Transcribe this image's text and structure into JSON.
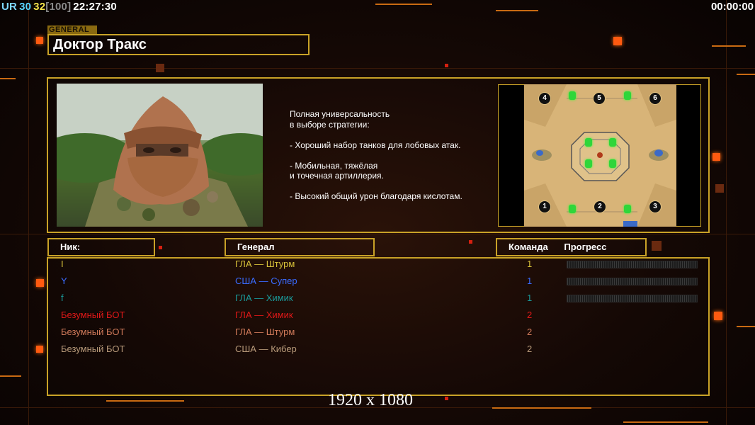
{
  "hud": {
    "left_items": [
      {
        "text": "UR",
        "color": "#7fd9ff"
      },
      {
        "text": "30",
        "color": "#5ad6ff"
      },
      {
        "text": "32",
        "color": "#f2e14a"
      },
      {
        "text": "[100]",
        "color": "#8a8a8a"
      },
      {
        "text": "22:27:30",
        "color": "#ffffff"
      }
    ],
    "timer": "00:00:00"
  },
  "general": {
    "tag": "GENERAL",
    "name": "Доктор Тракс",
    "description": [
      "Полная универсальность\nв выборе стратегии:",
      "- Хороший набор танков для лобовых атак.",
      "- Мобильная, тяжёлая\nи точечная артиллерия.",
      "- Высокий общий урон благодаря кислотам."
    ]
  },
  "map": {
    "slots": [
      "4",
      "5",
      "6",
      "1",
      "2",
      "3"
    ]
  },
  "table": {
    "headers": {
      "nick": "Ник:",
      "general": "Генерал",
      "team": "Команда",
      "progress": "Прогресс"
    },
    "players": [
      {
        "nick": "I",
        "general": "ГЛА — Штурм",
        "team": "1",
        "color": "#d8c23a",
        "progress": 0
      },
      {
        "nick": "Y",
        "general": "США — Супер",
        "team": "1",
        "color": "#3a6cff",
        "progress": 0
      },
      {
        "nick": "f",
        "general": "ГЛА — Химик",
        "team": "1",
        "color": "#1a9a9a",
        "progress": 0
      },
      {
        "nick": "Безумный БОТ",
        "general": "ГЛА — Химик",
        "team": "2",
        "color": "#e01818"
      },
      {
        "nick": "Безумный БОТ",
        "general": "ГЛА — Штурм",
        "team": "2",
        "color": "#d07a5a"
      },
      {
        "nick": "Безумный БОТ",
        "general": "США — Кибер",
        "team": "2",
        "color": "#b89a7a"
      }
    ]
  },
  "overlay": {
    "resolution": "1920 x 1080"
  }
}
